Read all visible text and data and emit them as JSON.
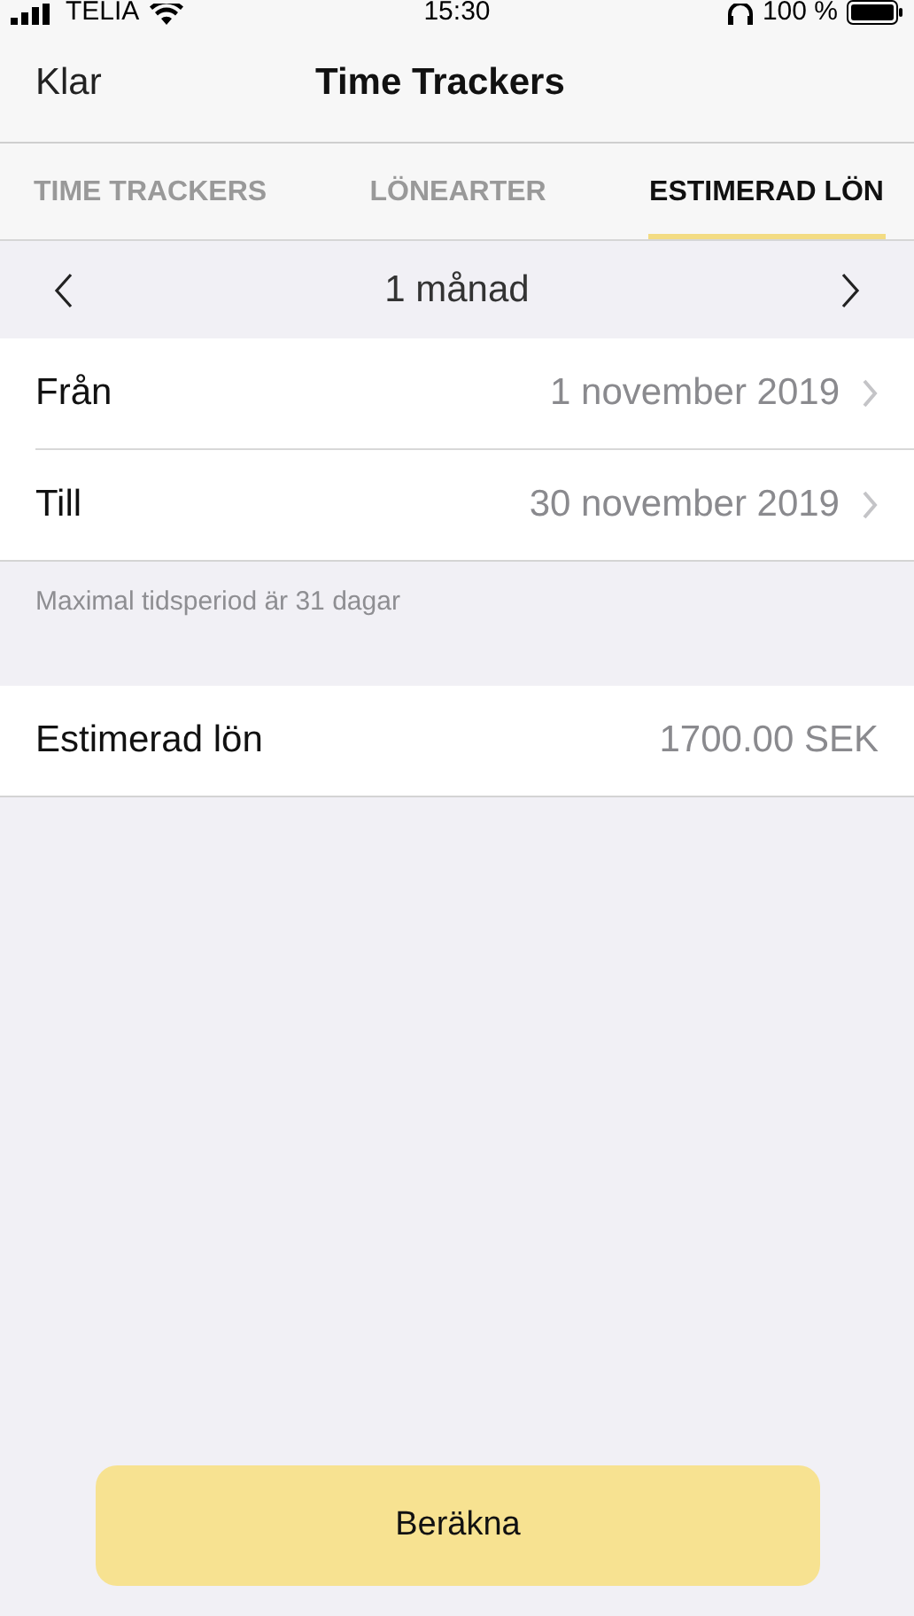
{
  "status_bar": {
    "carrier": "TELIA",
    "time": "15:30",
    "battery": "100 %"
  },
  "nav": {
    "left_button": "Klar",
    "title": "Time Trackers"
  },
  "tabs": [
    {
      "label": "TIME TRACKERS",
      "selected": false
    },
    {
      "label": "LÖNEARTER",
      "selected": false
    },
    {
      "label": "ESTIMERAD LÖN",
      "selected": true
    }
  ],
  "period": {
    "label": "1 månad"
  },
  "date_rows": [
    {
      "label": "Från",
      "value": "1 november 2019"
    },
    {
      "label": "Till",
      "value": "30 november 2019"
    }
  ],
  "footer_note": "Maximal tidsperiod är 31 dagar",
  "result": {
    "label": "Estimerad lön",
    "value": "1700.00 SEK"
  },
  "action_button": "Beräkna"
}
